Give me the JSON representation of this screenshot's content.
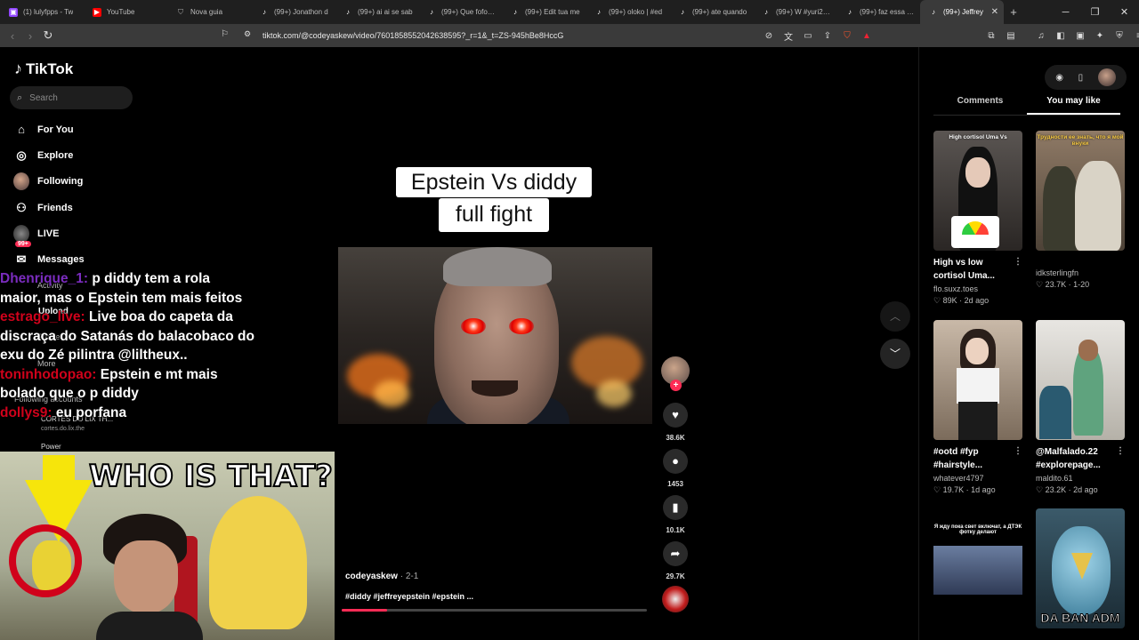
{
  "browser": {
    "tabs": [
      {
        "label": "(1) lulyfpps - Tw",
        "icon": "twitch-icon",
        "color": "#9146ff"
      },
      {
        "label": "YouTube",
        "icon": "youtube-icon",
        "color": "#ff0000"
      },
      {
        "label": "Nova guia",
        "icon": "shield-icon",
        "color": "#888888"
      },
      {
        "label": "(99+) Jonathon d",
        "icon": "tiktok-icon",
        "color": "#000000"
      },
      {
        "label": "(99+) ai ai se sab",
        "icon": "tiktok-icon",
        "color": "#000000"
      },
      {
        "label": "(99+) Que fofos 🥺",
        "icon": "tiktok-icon",
        "color": "#000000"
      },
      {
        "label": "(99+) Edit tua me",
        "icon": "tiktok-icon",
        "color": "#000000"
      },
      {
        "label": "(99+) oloko | #ed",
        "icon": "tiktok-icon",
        "color": "#000000"
      },
      {
        "label": "(99+) ate quando",
        "icon": "tiktok-icon",
        "color": "#000000"
      },
      {
        "label": "(99+) W #yuri22 #",
        "icon": "tiktok-icon",
        "color": "#000000"
      },
      {
        "label": "(99+) faz essa mu",
        "icon": "tiktok-icon",
        "color": "#000000"
      },
      {
        "label": "(99+) Jeffrey",
        "icon": "tiktok-icon",
        "color": "#000000"
      }
    ],
    "active_tab": 11,
    "url": "tiktok.com/@codeyaskew/video/7601858552042638595?_r=1&_t=ZS-945hBe8HccG"
  },
  "sidebar": {
    "brand": "TikTok",
    "search_placeholder": "Search",
    "nav": [
      {
        "label": "For You",
        "icon": "home-icon"
      },
      {
        "label": "Explore",
        "icon": "compass-icon"
      },
      {
        "label": "Following",
        "icon": "following-avatar"
      },
      {
        "label": "Friends",
        "icon": "friends-icon"
      },
      {
        "label": "LIVE",
        "icon": "live-avatar"
      },
      {
        "label": "Messages",
        "icon": "messages-icon",
        "badge": "99+"
      }
    ],
    "hidden_nav": {
      "activity": "Activity",
      "upload": "Upload",
      "profile": "Profile",
      "more": "More",
      "following_accounts": "Following accounts",
      "account_name": "CORTES DO LIX TH...",
      "account_handle": "cortes.do.lix.the",
      "account2": "Power"
    }
  },
  "chat": [
    {
      "user": "Dhenrique_1:",
      "text": " p diddy tem a rola",
      "user_color": "purple"
    },
    {
      "user": "",
      "text": "maior, mas o Epstein tem mais feitos"
    },
    {
      "user": "estrago_live:",
      "text": " Live boa do capeta da"
    },
    {
      "user": "",
      "text": "discraça do Satanás do balacobaco do"
    },
    {
      "user": "",
      "text": "exu do Zé pilintra @liltheux.."
    },
    {
      "user": "toninhodopao:",
      "text": " Epstein e mt mais"
    },
    {
      "user": "",
      "text": "bolado que o p diddy"
    },
    {
      "user": "dollys9:",
      "text": " eu porfana"
    }
  ],
  "cam_overlay": {
    "headline": "WHO IS THAT?"
  },
  "video": {
    "caption_line1": "Epstein Vs diddy",
    "caption_line2": "full fight",
    "author": "codeyaskew",
    "date": " · 2-1",
    "tags": "#diddy #jeffreyepstein #epstein ...",
    "progress": 0.15,
    "likes": "38.6K",
    "comments": "1453",
    "saves": "10.1K",
    "shares": "29.7K"
  },
  "right_panel": {
    "tabs": [
      "Comments",
      "You may like"
    ],
    "active_tab": 1,
    "cards": [
      {
        "title": "High vs low cortisol Uma...",
        "author": "flo.suxz.toes",
        "likes": "89K",
        "age": "2d ago",
        "thumb_text": "High cortisol  Uma Vs"
      },
      {
        "title": "",
        "author": "idksterlingfn",
        "likes": "23.7K",
        "age": "1-20",
        "thumb_text": "Трудности ее знать, что я мой внуки"
      },
      {
        "title": "#ootd #fyp #hairstyle...",
        "author": "whatever4797",
        "likes": "19.7K",
        "age": "1d ago",
        "thumb_text": ""
      },
      {
        "title": "@Malfalado.22 #explorepage...",
        "author": "maldito.61",
        "likes": "23.2K",
        "age": "2d ago",
        "thumb_text": ""
      },
      {
        "title": "",
        "author": "",
        "likes": "",
        "age": "",
        "thumb_text": "Я жду пока свет включат, а ДТЭК фотку делают"
      },
      {
        "title": "",
        "author": "",
        "likes": "",
        "age": "",
        "thumb_text": "DA BAN ADM"
      }
    ]
  }
}
